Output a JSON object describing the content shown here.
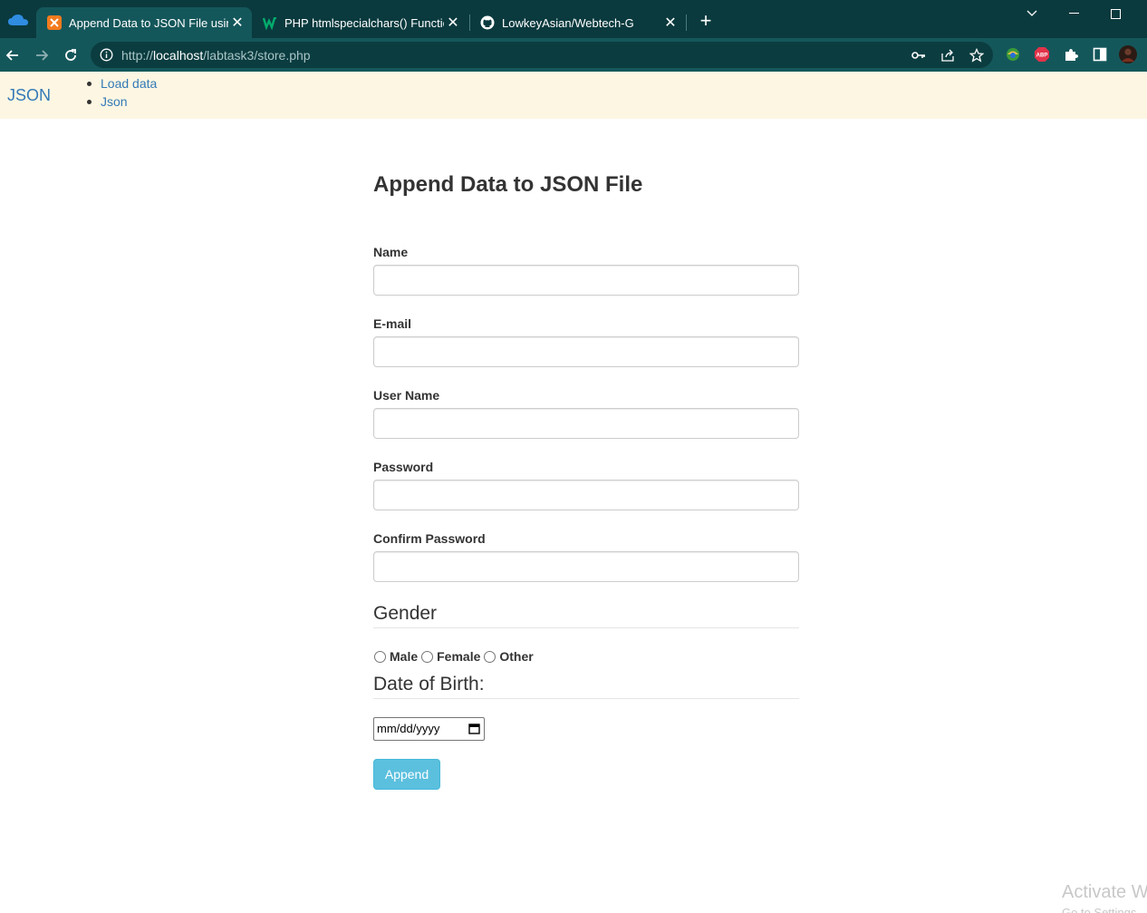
{
  "browser": {
    "tabs": [
      {
        "title": "Append Data to JSON File using",
        "active": true
      },
      {
        "title": "PHP htmlspecialchars() Function",
        "active": false
      },
      {
        "title": "LowkeyAsian/Webtech-G",
        "active": false
      }
    ],
    "url": {
      "scheme": "http://",
      "host": "localhost",
      "path": "/labtask3/store.php"
    },
    "extensions": {
      "abp_label": "ABP"
    }
  },
  "page": {
    "navbar": {
      "brand": "JSON",
      "links": [
        "Load data",
        "Json"
      ]
    },
    "heading": "Append Data to JSON File",
    "form": {
      "fields": [
        {
          "label": "Name",
          "value": ""
        },
        {
          "label": "E-mail",
          "value": ""
        },
        {
          "label": "User Name",
          "value": ""
        },
        {
          "label": "Password",
          "value": ""
        },
        {
          "label": "Confirm Password",
          "value": ""
        }
      ],
      "gender": {
        "legend": "Gender",
        "options": [
          "Male",
          "Female",
          "Other"
        ]
      },
      "dob": {
        "legend": "Date of Birth:",
        "placeholder": "mm/dd/yyyy"
      },
      "submit_label": "Append"
    },
    "watermark": {
      "line1": "Activate W",
      "line2": "Go to Settings"
    }
  },
  "colors": {
    "tabstrip": "#0a3a3e",
    "toolbar": "#14575b",
    "navbar_bg": "#fdf6e3",
    "link": "#337ab7",
    "button": "#5bc0de"
  }
}
